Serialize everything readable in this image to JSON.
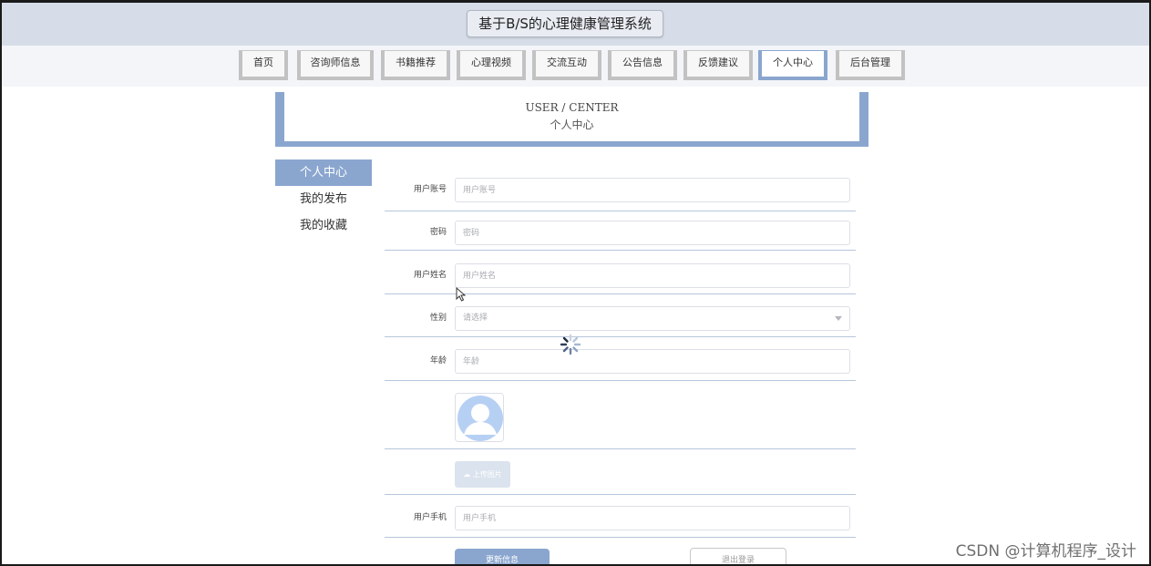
{
  "header": {
    "title": "基于B/S的心理健康管理系统"
  },
  "nav": {
    "items": [
      {
        "label": "首页"
      },
      {
        "label": "咨询师信息"
      },
      {
        "label": "书籍推荐"
      },
      {
        "label": "心理视频"
      },
      {
        "label": "交流互动"
      },
      {
        "label": "公告信息"
      },
      {
        "label": "反馈建议"
      },
      {
        "label": "个人中心"
      },
      {
        "label": "后台管理"
      }
    ],
    "active": "个人中心"
  },
  "banner": {
    "en": "USER / CENTER",
    "cn": "个人中心"
  },
  "side_menu": {
    "items": [
      {
        "label": "个人中心"
      },
      {
        "label": "我的发布"
      },
      {
        "label": "我的收藏"
      }
    ],
    "active": "个人中心"
  },
  "form": {
    "username": {
      "label": "用户账号",
      "placeholder": "用户账号"
    },
    "password": {
      "label": "密码",
      "placeholder": "密码"
    },
    "fullname": {
      "label": "用户姓名",
      "placeholder": "用户姓名"
    },
    "gender": {
      "label": "性别",
      "placeholder": "请选择"
    },
    "age": {
      "label": "年龄",
      "placeholder": "年龄"
    },
    "upload_label": "上传图片",
    "phone": {
      "label": "用户手机",
      "placeholder": "用户手机"
    },
    "update_label": "更新信息",
    "logout_label": "退出登录"
  },
  "colors": {
    "accent": "#8aa6cf",
    "header_bg": "#d6dde8"
  },
  "icons": {
    "avatar": "user-avatar-icon",
    "upload": "cloud-upload-icon",
    "select": "chevron-down-icon",
    "loading": "loading-spinner-icon",
    "cursor": "mouse-cursor-icon"
  },
  "watermark": "CSDN @计算机程序_设计"
}
